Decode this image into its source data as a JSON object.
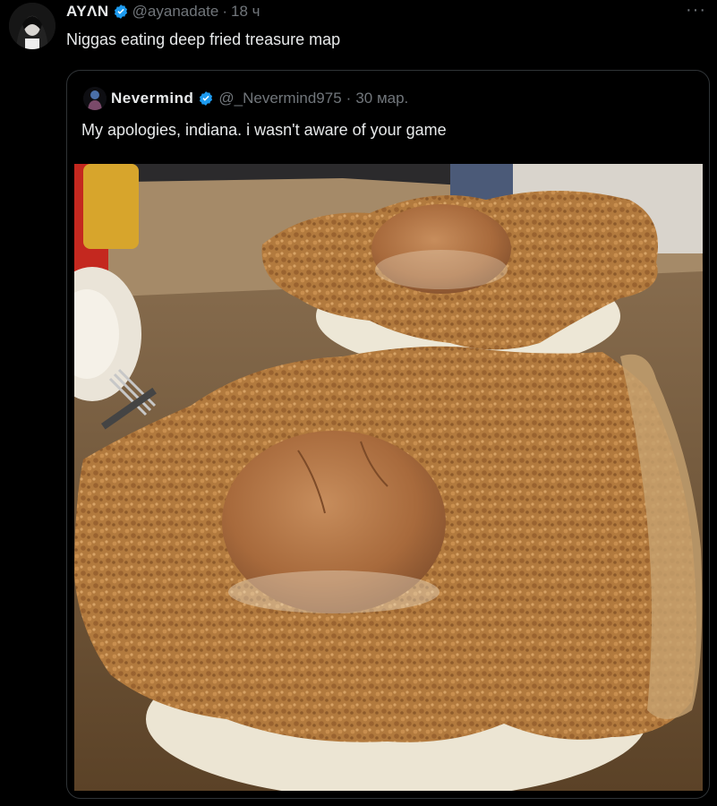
{
  "tweet": {
    "display_name": "AYΛN",
    "handle": "@ayanadate",
    "separator": "·",
    "time": "18 ч",
    "text": "Niggas eating deep fried treasure map",
    "more_label": "···"
  },
  "quote": {
    "display_name": "Nevermind",
    "handle": "@_Nevermind975",
    "separator": "·",
    "time": "30 мар.",
    "text": "My apologies, indiana. i wasn't aware of your game",
    "photo_subject": "two plates of oversized breaded pork tenderloin cutlets with small hamburger buns on top"
  },
  "colors": {
    "background": "#000000",
    "text": "#e7e9ea",
    "secondary": "#71767b",
    "verified": "#1d9bf0",
    "border": "#2f3336"
  }
}
